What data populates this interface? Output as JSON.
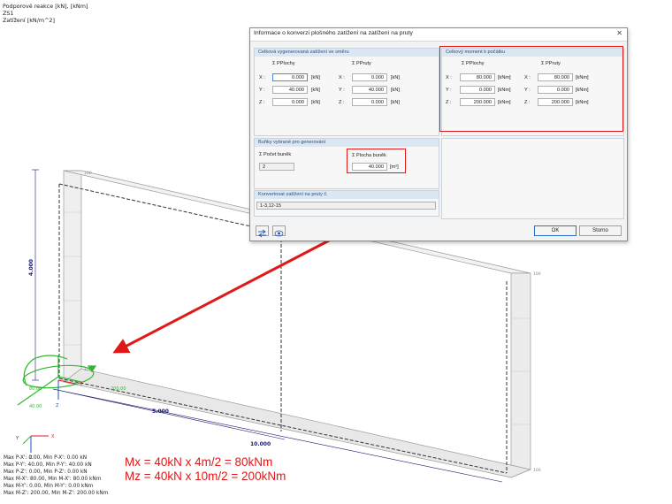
{
  "header": {
    "line1": "Podporové reakce [kN], [kNm]",
    "line2": "ZS1",
    "line3": "Zatížení [kN/m^2]"
  },
  "model": {
    "dim_height": "4.000",
    "dim_half": "5.000",
    "dim_full": "10.000",
    "node_label": "100",
    "reaction_vals": [
      "80.00",
      "40.00",
      "200.00"
    ],
    "axis_x": "X",
    "axis_z": "Z"
  },
  "summary": [
    "Max P-X': 0.00, Min P-X': 0.00 kN",
    "Max P-Y': 40.00, Min P-Y': 40.00 kN",
    "Max P-Z': 0.00, Min P-Z': 0.00 kN",
    "Max M-X': 80.00, Min M-X': 80.00 kNm",
    "Max M-Y': 0.00, Min M-Y': 0.00 kNm",
    "Max M-Z': 200.00, Min M-Z': 200.00 kNm"
  ],
  "annotation": {
    "mx": "Mx = 40kN x 4m/2 = 80kNm",
    "mz": "Mz = 40kN x 10m/2 = 200kNm"
  },
  "dialog": {
    "title": "Informace o konverzi plošného zatížení na zatížení na pruty",
    "load_panel": {
      "title": "Celková vygenerovaná zatížení ve směru",
      "col1_header": "Σ PPlochy",
      "col2_header": "Σ PPruty",
      "rows": [
        {
          "axis": "X :",
          "plochy": "0.000",
          "pruty": "0.000"
        },
        {
          "axis": "Y :",
          "plochy": "40.000",
          "pruty": "40.000"
        },
        {
          "axis": "Z :",
          "plochy": "0.000",
          "pruty": "0.000"
        }
      ],
      "unit": "[kN]"
    },
    "moment_panel": {
      "title": "Celkový moment k počátku",
      "col1_header": "Σ PPlochy",
      "col2_header": "Σ PPruty",
      "rows": [
        {
          "axis": "X :",
          "plochy": "80.000",
          "pruty": "80.000"
        },
        {
          "axis": "Y :",
          "plochy": "0.000",
          "pruty": "0.000"
        },
        {
          "axis": "Z :",
          "plochy": "200.000",
          "pruty": "200.000"
        }
      ],
      "unit": "[kNm]"
    },
    "cells_panel": {
      "title": "Buňky vybrané pro generování",
      "count_label": "Σ Počet buněk",
      "count_value": "2",
      "area_label": "Σ Plocha buněk",
      "area_value": "40.000",
      "area_unit": "[m²]"
    },
    "convert_panel": {
      "title": "Konvertovat zatížení na pruty č.",
      "value": "1-3,12-15"
    },
    "ok_label": "OK",
    "cancel_label": "Storno"
  },
  "colors": {
    "accent_red": "#e01818",
    "reaction_green": "#2fb82f",
    "panel_header": "#dbe7f3"
  }
}
